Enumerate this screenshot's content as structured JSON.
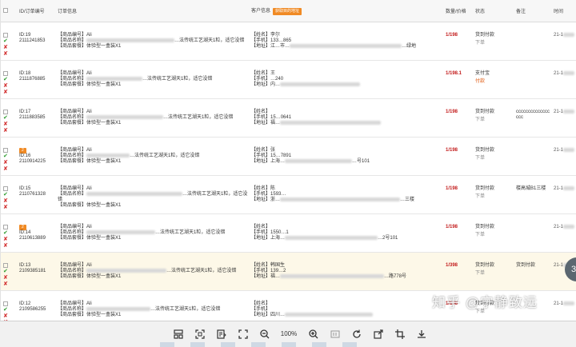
{
  "headers": {
    "id": "ID/订单编号",
    "order_info": "订单信息",
    "customer": "客户信息",
    "customer_badge": "获取目的地址",
    "price": "数量/价格",
    "status": "状态",
    "note": "备注",
    "time": "时间"
  },
  "labels": {
    "goods_no": "【商品编号】",
    "goods_name": "【商品名称】",
    "goods_pkg": "【商品套餐】",
    "name": "【姓名】",
    "phone": "【手机】",
    "address": "【地址】"
  },
  "orders": [
    {
      "id": "ID:19",
      "order_no": "2111241853",
      "badge": "",
      "goods_no": "Ali",
      "goods_name_tail": "…法传统工艺湖天1粒，适它没错",
      "goods_pkg": "体验型一盒装X1",
      "name": "李尔",
      "phone": "133…865",
      "address": "江…市…",
      "addr_tail": "…绿地",
      "price": "1/198",
      "status": "货到付款",
      "status_sub": "下单",
      "note": "",
      "time": "21-1"
    },
    {
      "id": "ID:18",
      "order_no": "2111876885",
      "badge": "",
      "goods_no": "Ali",
      "goods_name_tail": "…法传统工艺湖天1粒，适它没错",
      "goods_pkg": "体验型一盒装X1",
      "name": "王",
      "phone": "…240",
      "address": "内…",
      "addr_tail": "",
      "price": "1/198.1",
      "status": "支付宝",
      "status_sub": "付款",
      "note": "",
      "time": "21-1"
    },
    {
      "id": "ID:17",
      "order_no": "2111883585",
      "badge": "",
      "goods_no": "Ali",
      "goods_name_tail": "…法传统工艺湖天1粒，适它没错",
      "goods_pkg": "体验型一盒装X1",
      "name": "",
      "phone": "15…0641",
      "address": "福…",
      "addr_tail": "",
      "price": "1/198",
      "status": "货到付款",
      "status_sub": "下单",
      "note": "cccccccccccccc ccc",
      "time": "21-1"
    },
    {
      "id": "ID:16",
      "order_no": "2110914225",
      "badge": "2",
      "goods_no": "Ali",
      "goods_name_tail": "…法传统工艺湖天1粒，适它没错",
      "goods_pkg": "体验型一盒装X1",
      "name": "张",
      "phone": "15…7891",
      "address": "上海…",
      "addr_tail": "…号101",
      "price": "1/198",
      "status": "货到付款",
      "status_sub": "下单",
      "note": "",
      "time": "21-1"
    },
    {
      "id": "ID:15",
      "order_no": "2110761328",
      "badge": "",
      "goods_no": "Ali",
      "goods_name_tail": "…法传统工艺湖天1粒，适它没错",
      "goods_pkg": "体验型一盒装X1",
      "name": "陈",
      "phone": "1593…",
      "address": "浙…",
      "addr_tail": "…三楼",
      "price": "1/198",
      "status": "货到付款",
      "status_sub": "下单",
      "note": "楼高城B1三楼",
      "time": "21-1"
    },
    {
      "id": "ID:14",
      "order_no": "2110613889",
      "badge": "2",
      "goods_no": "Ali",
      "goods_name_tail": "…法传统工艺湖天1粒，适它没错",
      "goods_pkg": "体验型一盒装X1",
      "name": "",
      "phone": "1550…1",
      "address": "上海…",
      "addr_tail": "…2号101",
      "price": "1/198",
      "status": "货到付款",
      "status_sub": "下单",
      "note": "",
      "time": "21-1"
    },
    {
      "id": "ID:13",
      "order_no": "2109385181",
      "badge": "",
      "goods_no": "Ali",
      "goods_name_tail": "…法传统工艺湖天1粒，适它没错",
      "goods_pkg": "体验型一盒装X1",
      "name": "韩国生",
      "phone": "139…2",
      "address": "福…",
      "addr_tail": "…路778号",
      "price": "1/398",
      "status": "货到付款",
      "status_sub": "下单",
      "note": "货到付款",
      "time": "21-1"
    },
    {
      "id": "ID:12",
      "order_no": "2109586255",
      "badge": "",
      "goods_no": "Ali",
      "goods_name_tail": "…法传统工艺湖天1粒，适它没错",
      "goods_pkg": "体验型一盒装X1",
      "name": "",
      "phone": "",
      "address": "四川…",
      "addr_tail": "",
      "price": "1/198",
      "status": "货到付款",
      "status_sub": "下单",
      "note": "",
      "time": "21-1"
    }
  ],
  "toolbar": {
    "zoom": "100%",
    "icons": [
      "layout-icon",
      "scan-icon",
      "extract-text-icon",
      "fit-screen-icon",
      "zoom-out-icon",
      "zoom-in-icon",
      "actual-size-icon",
      "rotate-icon",
      "open-external-icon",
      "crop-icon",
      "download-icon"
    ]
  },
  "watermark": "知乎 @宁静致远",
  "side_badge": "3",
  "colors": {
    "accent": "#f08a24",
    "price": "#c31c1c",
    "check": "#2e9b2e",
    "cross": "#d23030",
    "highlight": "#fdf8e8"
  }
}
